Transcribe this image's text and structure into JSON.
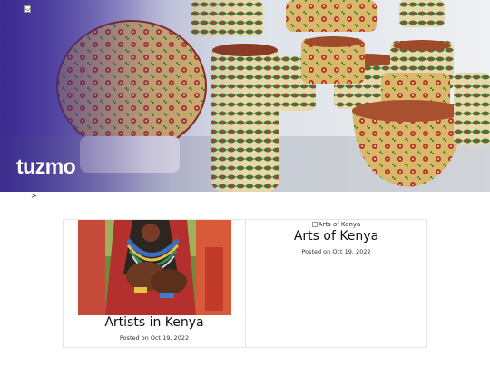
{
  "brand": {
    "logo_text": "tuzmo"
  },
  "breadcrumb": {
    "separator": ">"
  },
  "hero": {
    "image_icon": "broken-image-icon"
  },
  "cards": [
    {
      "title": "Artists in Kenya",
      "date": "Posted on Oct 19, 2022",
      "thumb": "beadwork-hands-image"
    },
    {
      "title": "Arts of Kenya",
      "date": "Posted on Oct 19, 2022",
      "image_alt": "Arts of Kenya"
    }
  ],
  "colors": {
    "text": "#111111",
    "border": "#e5e5e5",
    "hero_overlay": "#3a2a8c"
  }
}
